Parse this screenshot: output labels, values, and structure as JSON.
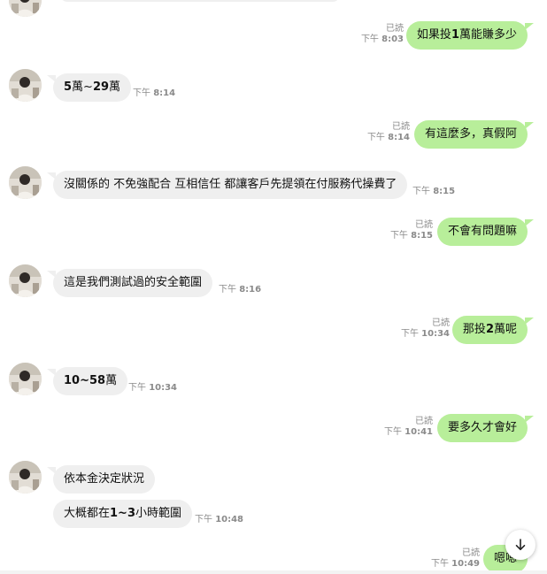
{
  "colors": {
    "outgoing_bubble": "#b8ee9a",
    "incoming_bubble": "#efefef",
    "meta_text": "#8a8a8a",
    "background": "#ffffff"
  },
  "read_label": "已読",
  "messages": [
    {
      "dir": "out",
      "text": "如果投1萬能賺多少",
      "read": true,
      "time_prefix": "下午",
      "time": "8:03"
    },
    {
      "dir": "in",
      "text": "5萬~29萬",
      "time_prefix": "下午",
      "time": "8:14"
    },
    {
      "dir": "out",
      "text": "有這麼多，真假阿",
      "read": true,
      "time_prefix": "下午",
      "time": "8:14"
    },
    {
      "dir": "in",
      "text": "沒關係的 不免強配合 互相信任  都讓客戶先提領在付服務代操費了",
      "time_prefix": "下午",
      "time": "8:15"
    },
    {
      "dir": "out",
      "text": "不會有問題嘛",
      "read": true,
      "time_prefix": "下午",
      "time": "8:15"
    },
    {
      "dir": "in",
      "text": "這是我們測試過的安全範圍",
      "time_prefix": "下午",
      "time": "8:16"
    },
    {
      "dir": "out",
      "text": "那投2萬呢",
      "read": true,
      "time_prefix": "下午",
      "time": "10:34"
    },
    {
      "dir": "in",
      "text": "10~58萬",
      "time_prefix": "下午",
      "time": "10:34"
    },
    {
      "dir": "out",
      "text": "要多久才會好",
      "read": true,
      "time_prefix": "下午",
      "time": "10:41"
    },
    {
      "dir": "in",
      "text": "依本金決定狀況"
    },
    {
      "dir": "in",
      "text": "大概都在1~3小時範圍",
      "time_prefix": "下午",
      "time": "10:48"
    },
    {
      "dir": "out",
      "text": "嗯嗯",
      "read": true,
      "time_prefix": "下午",
      "time": "10:49"
    }
  ],
  "scroll_button": {
    "icon": "arrow-down-icon"
  }
}
